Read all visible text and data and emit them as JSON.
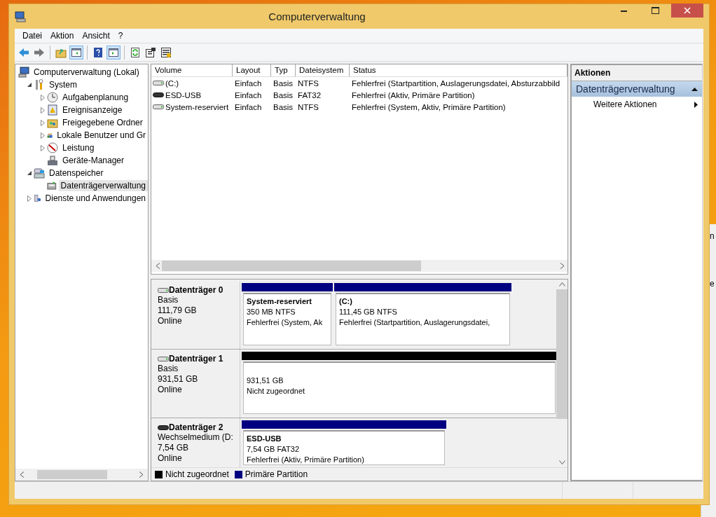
{
  "window": {
    "title": "Computerverwaltung"
  },
  "menu": [
    "Datei",
    "Aktion",
    "Ansicht",
    "?"
  ],
  "toolbar": [
    {
      "kind": "back",
      "pressed": false
    },
    {
      "kind": "forward",
      "pressed": false
    },
    {
      "kind": "sep"
    },
    {
      "kind": "up",
      "pressed": false
    },
    {
      "kind": "tree",
      "pressed": true
    },
    {
      "kind": "sep"
    },
    {
      "kind": "help",
      "pressed": false
    },
    {
      "kind": "pane",
      "pressed": true
    },
    {
      "kind": "sep"
    },
    {
      "kind": "refresh",
      "pressed": false
    },
    {
      "kind": "properties",
      "pressed": false
    },
    {
      "kind": "export",
      "pressed": false
    }
  ],
  "tree": [
    {
      "label": "Computerverwaltung (Lokal)",
      "kind": "computer",
      "selected": false,
      "children": [
        {
          "label": "System",
          "kind": "tools",
          "expanded": true,
          "selected": false,
          "children": [
            {
              "label": "Aufgabenplanung",
              "kind": "clock",
              "expanded": false,
              "selected": false
            },
            {
              "label": "Ereignisanzeige",
              "kind": "event",
              "expanded": false,
              "selected": false
            },
            {
              "label": "Freigegebene Ordner",
              "kind": "share",
              "expanded": false,
              "selected": false
            },
            {
              "label": "Lokale Benutzer und Gr",
              "kind": "users",
              "expanded": false,
              "selected": false
            },
            {
              "label": "Leistung",
              "kind": "perf",
              "expanded": false,
              "selected": false
            },
            {
              "label": "Geräte-Manager",
              "kind": "devices",
              "selected": false
            }
          ]
        },
        {
          "label": "Datenspeicher",
          "kind": "storage",
          "expanded": true,
          "selected": false,
          "children": [
            {
              "label": "Datenträgerverwaltung",
              "kind": "disk",
              "selected": true
            }
          ]
        },
        {
          "label": "Dienste und Anwendungen",
          "kind": "services",
          "expanded": false,
          "selected": false
        }
      ]
    }
  ],
  "volumes": {
    "columns": [
      "Volume",
      "Layout",
      "Typ",
      "Dateisystem",
      "Status"
    ],
    "rows": [
      {
        "kind": "hdd",
        "cells": [
          "(C:)",
          "Einfach",
          "Basis",
          "NTFS",
          "Fehlerfrei (Startpartition, Auslagerungsdatei, Absturzabbild"
        ]
      },
      {
        "kind": "usb",
        "cells": [
          "ESD-USB",
          "Einfach",
          "Basis",
          "FAT32",
          "Fehlerfrei (Aktiv, Primäre Partition)"
        ]
      },
      {
        "kind": "hdd",
        "cells": [
          "System-reserviert",
          "Einfach",
          "Basis",
          "NTFS",
          "Fehlerfrei (System, Aktiv, Primäre Partition)"
        ]
      }
    ]
  },
  "disks": [
    {
      "name": "Datenträger 0",
      "kind": "hdd",
      "details": [
        "Basis",
        "111,79 GB",
        "Online"
      ],
      "partitions": [
        {
          "title": "System-reserviert",
          "size": "350 MB NTFS",
          "status": "Fehlerfrei (System, Ak",
          "color": "#000080"
        },
        {
          "title": "(C:)",
          "size": "111,45 GB NTFS",
          "status": "Fehlerfrei (Startpartition, Auslagerungsdatei,",
          "color": "#000080"
        }
      ]
    },
    {
      "name": "Datenträger 1",
      "kind": "hdd",
      "details": [
        "Basis",
        "931,51 GB",
        "Online"
      ],
      "partitions": [
        {
          "size": "931,51 GB",
          "status": "Nicht zugeordnet",
          "color": "#000000"
        }
      ]
    },
    {
      "name": "Datenträger 2",
      "kind": "usb",
      "details": [
        "Wechselmedium (D:",
        "7,54 GB",
        "Online"
      ],
      "partitions": [
        {
          "title": "ESD-USB",
          "size": "7,54 GB FAT32",
          "status": "Fehlerfrei (Aktiv, Primäre Partition)",
          "color": "#000080"
        }
      ]
    }
  ],
  "legend": [
    {
      "label": "Nicht zugeordnet",
      "color": "#000000"
    },
    {
      "label": "Primäre Partition",
      "color": "#000080"
    }
  ],
  "actions": {
    "title": "Aktionen",
    "section": {
      "label": "Datenträgerverwaltung",
      "expanded": true
    },
    "items": [
      "Weitere Aktionen"
    ]
  },
  "background_window": {
    "texts": [
      "n",
      "e"
    ]
  }
}
